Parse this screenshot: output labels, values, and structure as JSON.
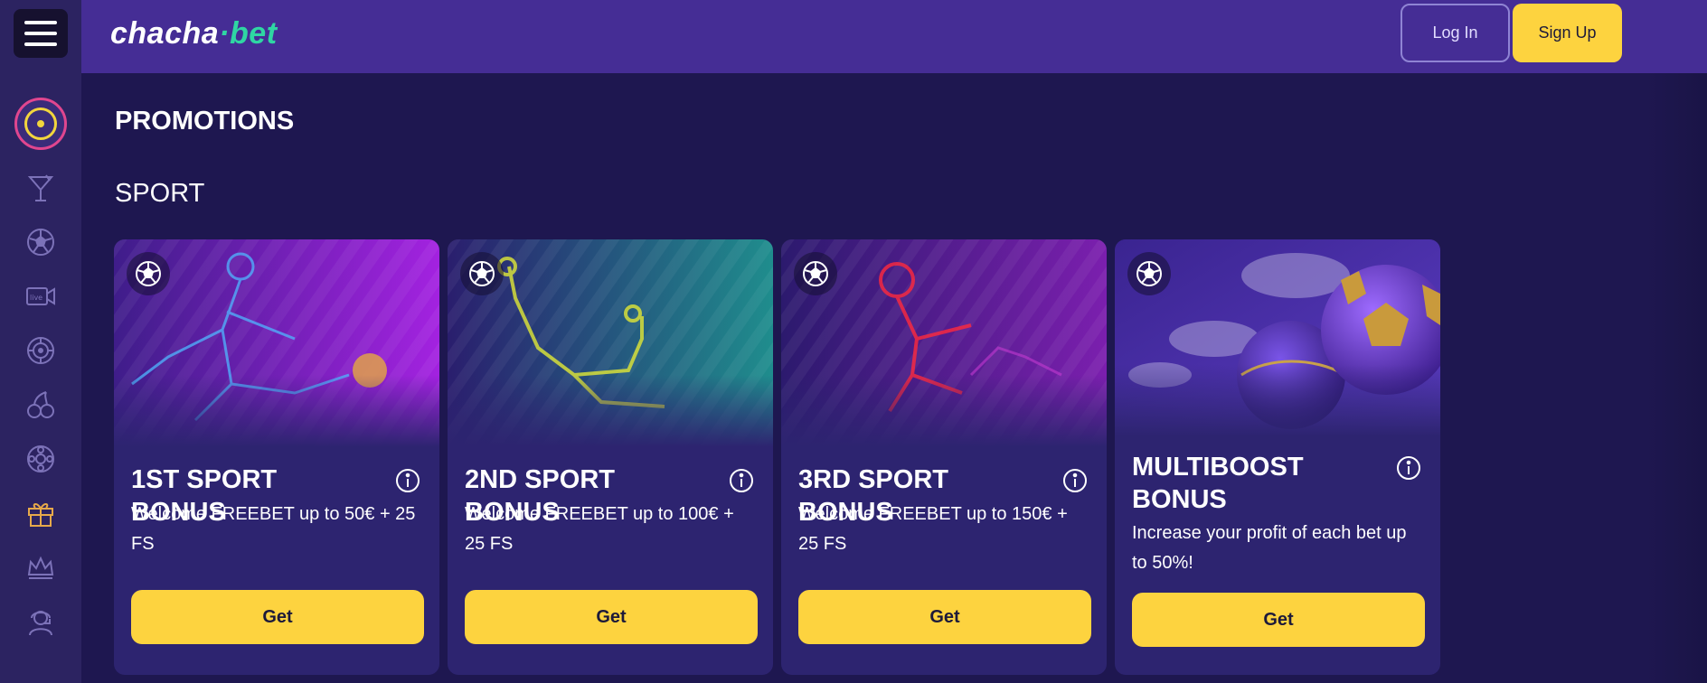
{
  "header": {
    "logo_part1": "chacha",
    "logo_part2": "·bet",
    "login_label": "Log In",
    "signup_label": "Sign Up"
  },
  "sidebar": {
    "icons": [
      "target-icon",
      "cocktail-icon",
      "soccer-ball-icon",
      "live-camera-icon",
      "roulette-icon",
      "cherries-icon",
      "lottery-ball-icon",
      "gift-icon",
      "crown-icon",
      "support-agent-icon"
    ],
    "active_index": 0
  },
  "page": {
    "title": "PROMOTIONS",
    "section": "SPORT"
  },
  "cards": [
    {
      "title": "1ST SPORT BONUS",
      "description": "Welcome FREEBET up to 50€ + 25 FS",
      "button": "Get",
      "badge_icon": "soccer-ball-icon",
      "theme_color": "#8a24d6"
    },
    {
      "title": "2ND SPORT BONUS",
      "description": "Welcome FREEBET up to 100€ + 25 FS",
      "button": "Get",
      "badge_icon": "soccer-ball-icon",
      "theme_color": "#1a8a8a"
    },
    {
      "title": "3RD SPORT BONUS",
      "description": "Welcome FREEBET up to 150€ + 25 FS",
      "button": "Get",
      "badge_icon": "soccer-ball-icon",
      "theme_color": "#7a1fb0"
    },
    {
      "title": "MULTIBOOST BONUS",
      "description": "Increase your profit of each bet up to 50%!",
      "button": "Get",
      "badge_icon": "soccer-ball-icon",
      "theme_color": "#4a2ea6"
    }
  ],
  "colors": {
    "accent_yellow": "#fdd33f",
    "logo_green": "#2fd6a3",
    "header_bg": "#452d95",
    "page_bg": "#1e1750",
    "card_bg": "#2d2470"
  }
}
